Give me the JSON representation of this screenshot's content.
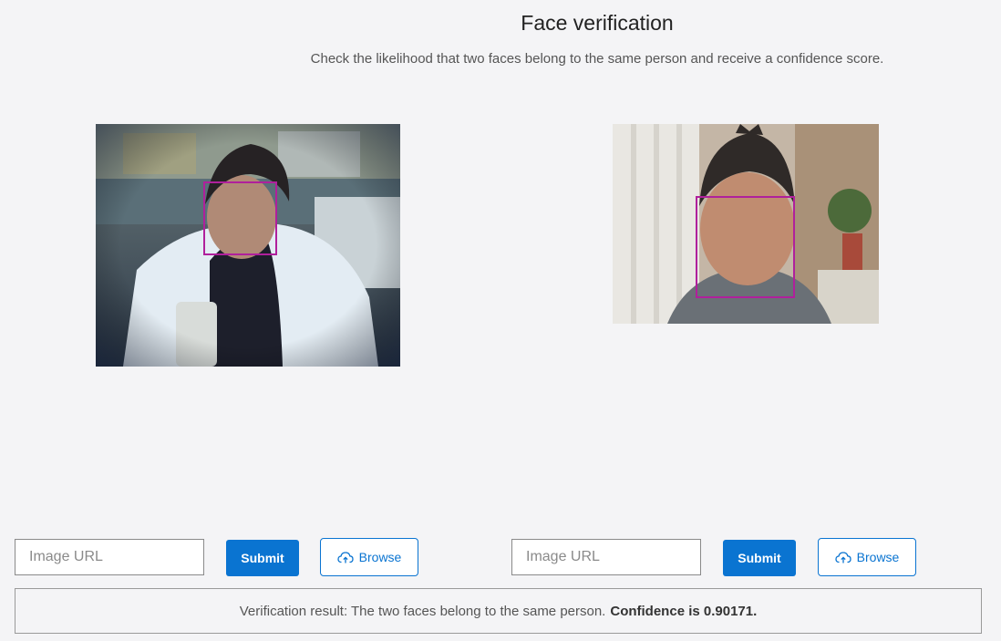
{
  "header": {
    "title": "Face verification",
    "subtitle": "Check the likelihood that two faces belong to the same person and receive a confidence score."
  },
  "left_panel": {
    "image_alt": "Left face image",
    "url_placeholder": "Image URL",
    "submit_label": "Submit",
    "browse_label": "Browse",
    "browse_icon": "upload-cloud-icon",
    "face_box_color": "#b0209c"
  },
  "right_panel": {
    "image_alt": "Right face image",
    "url_placeholder": "Image URL",
    "submit_label": "Submit",
    "browse_label": "Browse",
    "browse_icon": "upload-cloud-icon",
    "face_box_color": "#b0209c"
  },
  "result": {
    "text": "Verification result: The two faces belong to the same person.",
    "confidence": "Confidence is 0.90171."
  },
  "colors": {
    "accent": "#0a74d1",
    "background": "#f4f4f6"
  }
}
